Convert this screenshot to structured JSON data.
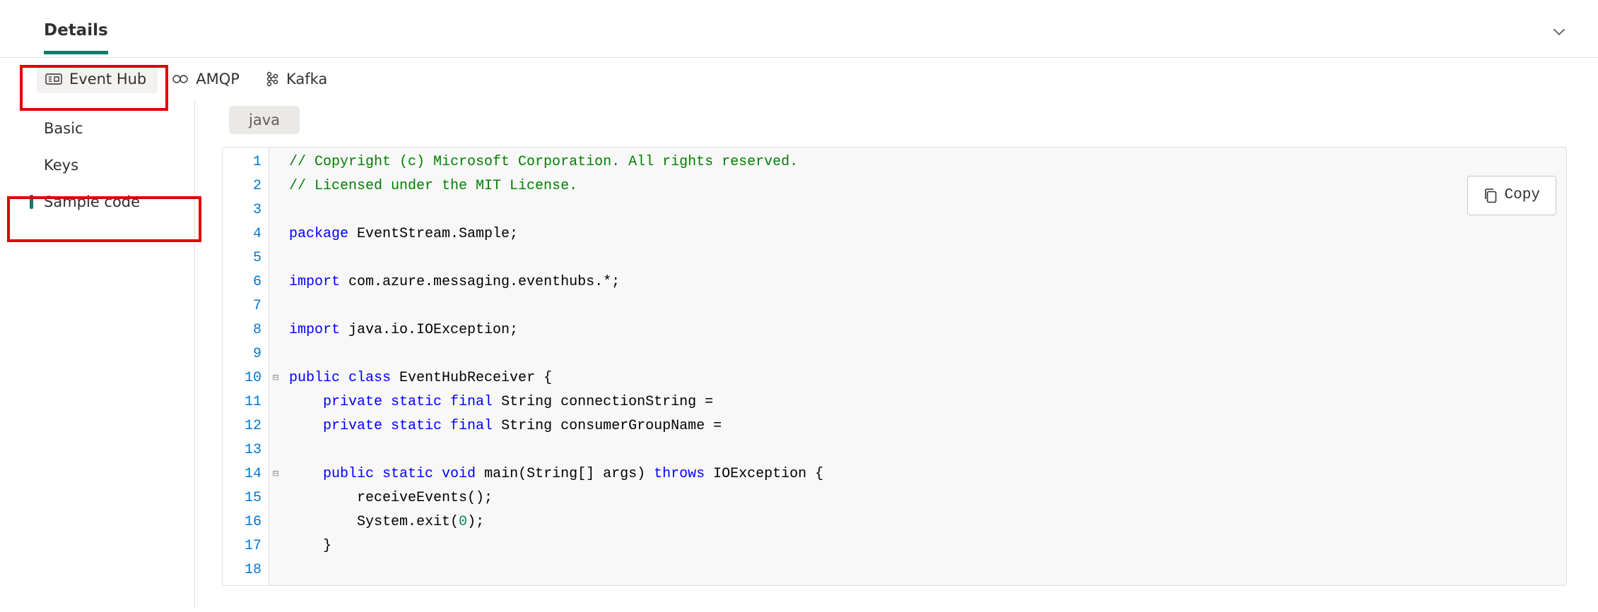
{
  "header": {
    "tab_label": "Details"
  },
  "protocols": {
    "items": [
      {
        "label": "Event Hub",
        "icon": "eventhub-icon",
        "active": true
      },
      {
        "label": "AMQP",
        "icon": "amqp-icon",
        "active": false
      },
      {
        "label": "Kafka",
        "icon": "kafka-icon",
        "active": false
      }
    ]
  },
  "sidebar": {
    "items": [
      {
        "label": "Basic",
        "selected": false
      },
      {
        "label": "Keys",
        "selected": false
      },
      {
        "label": "Sample code",
        "selected": true
      }
    ]
  },
  "main": {
    "language_pill": "java",
    "copy_label": "Copy",
    "code": {
      "lines": [
        {
          "n": 1,
          "fold": "",
          "segments": [
            {
              "cls": "tok-comment",
              "t": "// Copyright (c) Microsoft Corporation. All rights reserved."
            }
          ]
        },
        {
          "n": 2,
          "fold": "",
          "segments": [
            {
              "cls": "tok-comment",
              "t": "// Licensed under the MIT License."
            }
          ]
        },
        {
          "n": 3,
          "fold": "",
          "segments": []
        },
        {
          "n": 4,
          "fold": "",
          "segments": [
            {
              "cls": "tok-kw",
              "t": "package"
            },
            {
              "cls": "tok-plain",
              "t": " EventStream.Sample;"
            }
          ]
        },
        {
          "n": 5,
          "fold": "",
          "segments": []
        },
        {
          "n": 6,
          "fold": "",
          "segments": [
            {
              "cls": "tok-kw",
              "t": "import"
            },
            {
              "cls": "tok-plain",
              "t": " com.azure.messaging.eventhubs.*;"
            }
          ]
        },
        {
          "n": 7,
          "fold": "",
          "segments": []
        },
        {
          "n": 8,
          "fold": "",
          "segments": [
            {
              "cls": "tok-kw",
              "t": "import"
            },
            {
              "cls": "tok-plain",
              "t": " java.io.IOException;"
            }
          ]
        },
        {
          "n": 9,
          "fold": "",
          "segments": []
        },
        {
          "n": 10,
          "fold": "⊟",
          "segments": [
            {
              "cls": "tok-kw",
              "t": "public class"
            },
            {
              "cls": "tok-plain",
              "t": " EventHubReceiver {"
            }
          ]
        },
        {
          "n": 11,
          "fold": "",
          "indent": "    ",
          "segments": [
            {
              "cls": "tok-kw",
              "t": "private static final"
            },
            {
              "cls": "tok-plain",
              "t": " String connectionString ="
            }
          ]
        },
        {
          "n": 12,
          "fold": "",
          "indent": "    ",
          "segments": [
            {
              "cls": "tok-kw",
              "t": "private static final"
            },
            {
              "cls": "tok-plain",
              "t": " String consumerGroupName ="
            }
          ]
        },
        {
          "n": 13,
          "fold": "",
          "indent": "",
          "segments": []
        },
        {
          "n": 14,
          "fold": "⊟",
          "indent": "    ",
          "segments": [
            {
              "cls": "tok-kw",
              "t": "public static void"
            },
            {
              "cls": "tok-plain",
              "t": " main(String[] args) "
            },
            {
              "cls": "tok-kw",
              "t": "throws"
            },
            {
              "cls": "tok-plain",
              "t": " IOException {"
            }
          ]
        },
        {
          "n": 15,
          "fold": "",
          "indent": "        ",
          "segments": [
            {
              "cls": "tok-plain",
              "t": "receiveEvents();"
            }
          ]
        },
        {
          "n": 16,
          "fold": "",
          "indent": "        ",
          "segments": [
            {
              "cls": "tok-plain",
              "t": "System.exit("
            },
            {
              "cls": "tok-num",
              "t": "0"
            },
            {
              "cls": "tok-plain",
              "t": ");"
            }
          ]
        },
        {
          "n": 17,
          "fold": "",
          "indent": "    ",
          "segments": [
            {
              "cls": "tok-plain",
              "t": "}"
            }
          ]
        },
        {
          "n": 18,
          "fold": "",
          "segments": []
        }
      ]
    }
  }
}
